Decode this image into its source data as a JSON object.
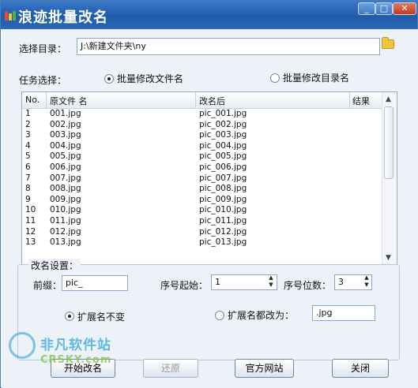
{
  "window": {
    "title": "浪迹批量改名",
    "controls": {
      "minimize": "_",
      "maximize": "□",
      "close": "✕"
    }
  },
  "directory": {
    "label": "选择目录：",
    "value": "J:\\新建文件夹\\ny"
  },
  "task": {
    "label": "任务选择：",
    "options": [
      "批量修改文件名",
      "批量修改目录名"
    ],
    "selected": 0
  },
  "table": {
    "columns": [
      "No.",
      "原文件 名",
      "改名后",
      "结果"
    ],
    "rows": [
      [
        "1",
        "001.jpg",
        "pic_001.jpg",
        ""
      ],
      [
        "2",
        "002.jpg",
        "pic_002.jpg",
        ""
      ],
      [
        "3",
        "003.jpg",
        "pic_003.jpg",
        ""
      ],
      [
        "4",
        "004.jpg",
        "pic_004.jpg",
        ""
      ],
      [
        "5",
        "005.jpg",
        "pic_005.jpg",
        ""
      ],
      [
        "6",
        "006.jpg",
        "pic_006.jpg",
        ""
      ],
      [
        "7",
        "007.jpg",
        "pic_007.jpg",
        ""
      ],
      [
        "8",
        "008.jpg",
        "pic_008.jpg",
        ""
      ],
      [
        "9",
        "009.jpg",
        "pic_009.jpg",
        ""
      ],
      [
        "10",
        "010.jpg",
        "pic_010.jpg",
        ""
      ],
      [
        "11",
        "011.jpg",
        "pic_011.jpg",
        ""
      ],
      [
        "12",
        "012.jpg",
        "pic_012.jpg",
        ""
      ],
      [
        "13",
        "013.jpg",
        "pic_013.jpg",
        ""
      ]
    ]
  },
  "settings": {
    "group_title": "改名设置：",
    "prefix_label": "前缀：",
    "prefix_value": "pic_",
    "start_label": "序号起始：",
    "start_value": "1",
    "digits_label": "序号位数：",
    "digits_value": "3",
    "ext_keep_label": "扩展名不变",
    "ext_change_label": "扩展名都改为：",
    "ext_value": ".jpg",
    "ext_selected": "keep"
  },
  "buttons": {
    "start": "开始改名",
    "restore": "还原",
    "website": "官方网站",
    "close": "关闭"
  },
  "watermark": {
    "line1": "非凡软件站",
    "line2": "CRSKY.com"
  }
}
